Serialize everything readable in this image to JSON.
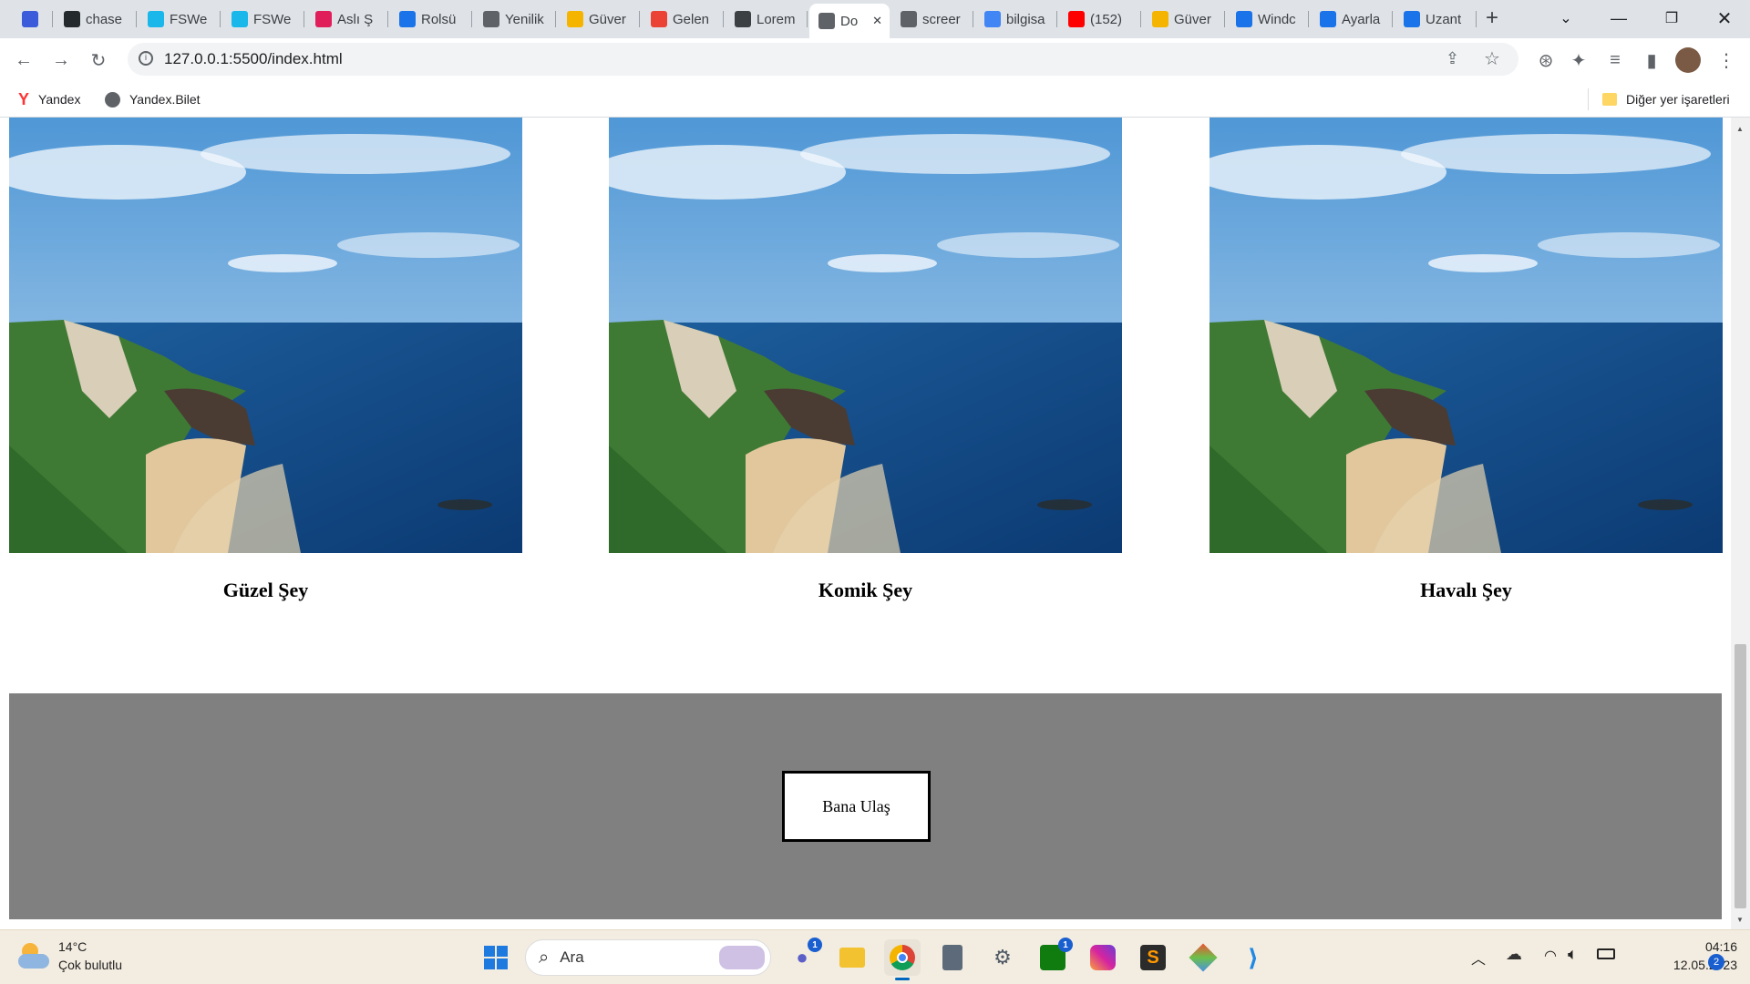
{
  "browser": {
    "tabs": [
      {
        "label": "",
        "icon": "extension-icon",
        "color": "#3b5bdb"
      },
      {
        "label": "chase",
        "icon": "github-icon",
        "color": "#24292e"
      },
      {
        "label": "FSWe",
        "icon": "vimeo-icon",
        "color": "#1ab7ea"
      },
      {
        "label": "FSWe",
        "icon": "vimeo-icon",
        "color": "#1ab7ea"
      },
      {
        "label": "Aslı Ş",
        "icon": "slack-icon",
        "color": "#e01e5a"
      },
      {
        "label": "Rolsü",
        "icon": "zoho-icon",
        "color": "#1a73e8"
      },
      {
        "label": "Yenilik",
        "icon": "chrome-icon",
        "color": "#5f6368"
      },
      {
        "label": "Güver",
        "icon": "check-icon",
        "color": "#f4b400"
      },
      {
        "label": "Gelen",
        "icon": "gmail-icon",
        "color": "#ea4335"
      },
      {
        "label": "Lorem",
        "icon": "image-icon",
        "color": "#3c4043"
      },
      {
        "label": "Do",
        "icon": "globe-icon",
        "color": "#5f6368",
        "active": true
      },
      {
        "label": "screer",
        "icon": "globe-icon",
        "color": "#5f6368"
      },
      {
        "label": "bilgisa",
        "icon": "google-icon",
        "color": "#4285f4"
      },
      {
        "label": "(152)",
        "icon": "youtube-icon",
        "color": "#ff0000"
      },
      {
        "label": "Güver",
        "icon": "check-icon",
        "color": "#f4b400"
      },
      {
        "label": "Windc",
        "icon": "tool-icon",
        "color": "#1a73e8"
      },
      {
        "label": "Ayarla",
        "icon": "gear-icon",
        "color": "#1a73e8"
      },
      {
        "label": "Uzant",
        "icon": "puzzle-icon",
        "color": "#1a73e8"
      }
    ],
    "new_tab": "+",
    "url": "127.0.0.1:5500/index.html",
    "bookmarks": [
      {
        "label": "Yandex",
        "icon": "yandex-icon"
      },
      {
        "label": "Yandex.Bilet",
        "icon": "globe-icon"
      }
    ],
    "other_bookmarks": "Diğer yer işaretleri"
  },
  "page": {
    "cards": [
      {
        "caption": "Güzel Şey"
      },
      {
        "caption": "Komik Şey"
      },
      {
        "caption": "Havalı Şey"
      }
    ],
    "contact_button": "Bana Ulaş",
    "footer_color": "#808080"
  },
  "taskbar": {
    "weather_temp": "14°C",
    "weather_desc": "Çok bulutlu",
    "search_placeholder": "Ara",
    "time": "04:16",
    "date": "12.05.2023",
    "notification_count": "2",
    "apps": [
      {
        "name": "windows-start-icon",
        "badge": ""
      },
      {
        "name": "teams-icon",
        "badge": "1"
      },
      {
        "name": "file-explorer-icon",
        "badge": ""
      },
      {
        "name": "chrome-icon",
        "badge": ""
      },
      {
        "name": "calculator-icon",
        "badge": ""
      },
      {
        "name": "settings-icon",
        "badge": ""
      },
      {
        "name": "xbox-icon",
        "badge": "1"
      },
      {
        "name": "instagram-icon",
        "badge": ""
      },
      {
        "name": "sublime-icon",
        "badge": ""
      },
      {
        "name": "git-icon",
        "badge": ""
      },
      {
        "name": "vscode-icon",
        "badge": ""
      }
    ]
  }
}
